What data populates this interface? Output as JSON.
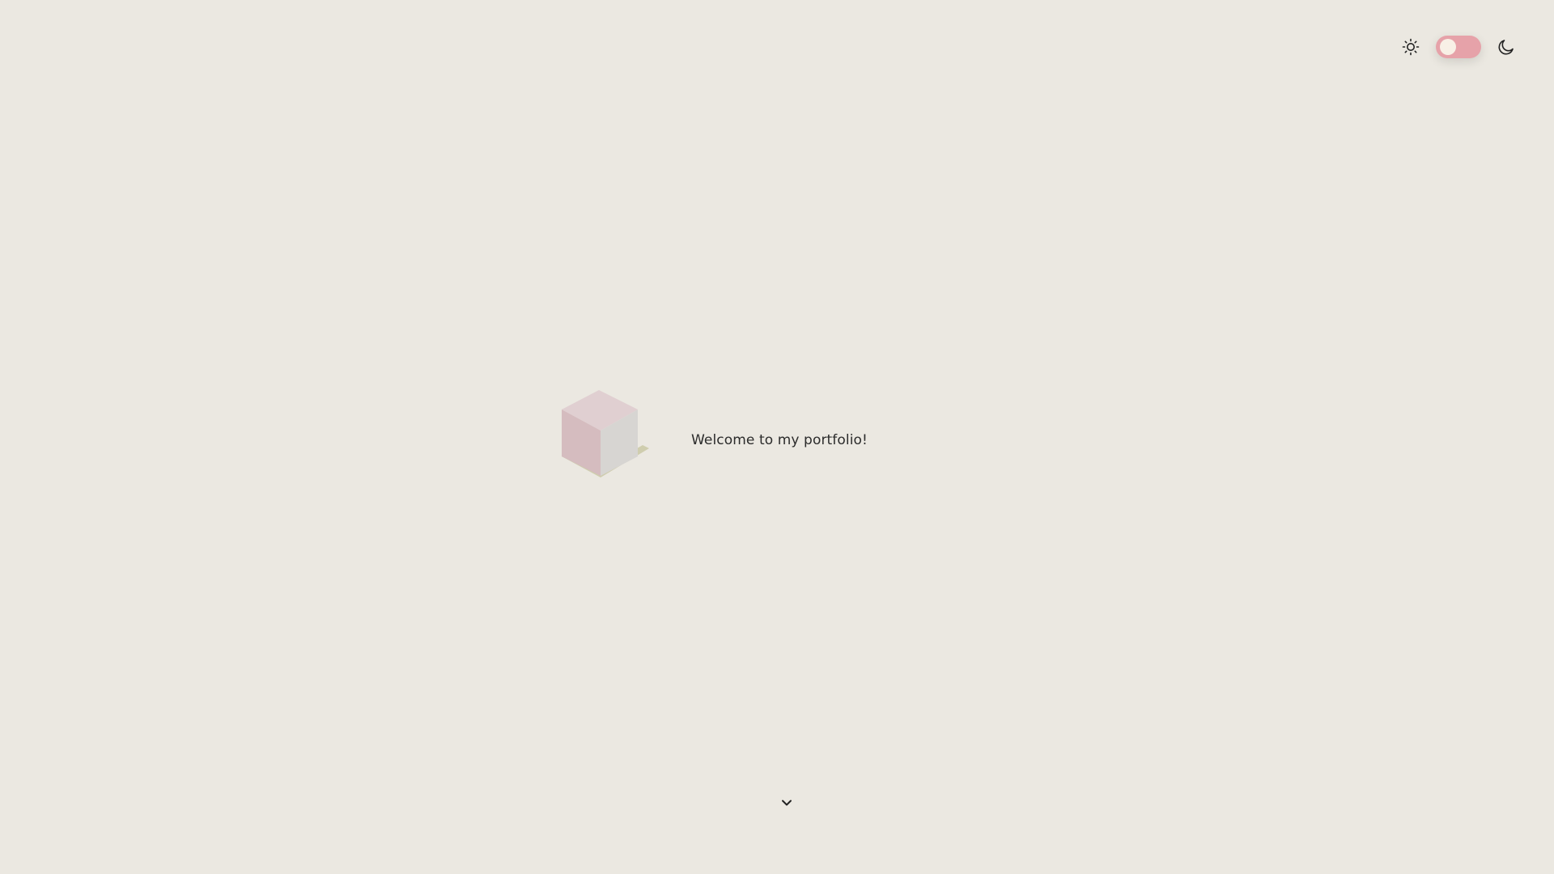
{
  "theme_toggle": {
    "light_icon": "sun-icon",
    "dark_icon": "moon-icon",
    "state": "light",
    "switch_color": "#e6a2a9",
    "knob_color": "#f8f0e6"
  },
  "hero": {
    "logo_icon": "cube-icon",
    "welcome_text": "Welcome to my portfolio!"
  },
  "scroll_indicator": {
    "icon": "chevron-down-icon"
  },
  "colors": {
    "background": "#ebe8e1",
    "text": "#2b2b2b",
    "cube_top": "#e0cfd1",
    "cube_left": "#d5bcbf",
    "cube_right": "#d7d5d2",
    "cube_base": "#cfcdae"
  }
}
